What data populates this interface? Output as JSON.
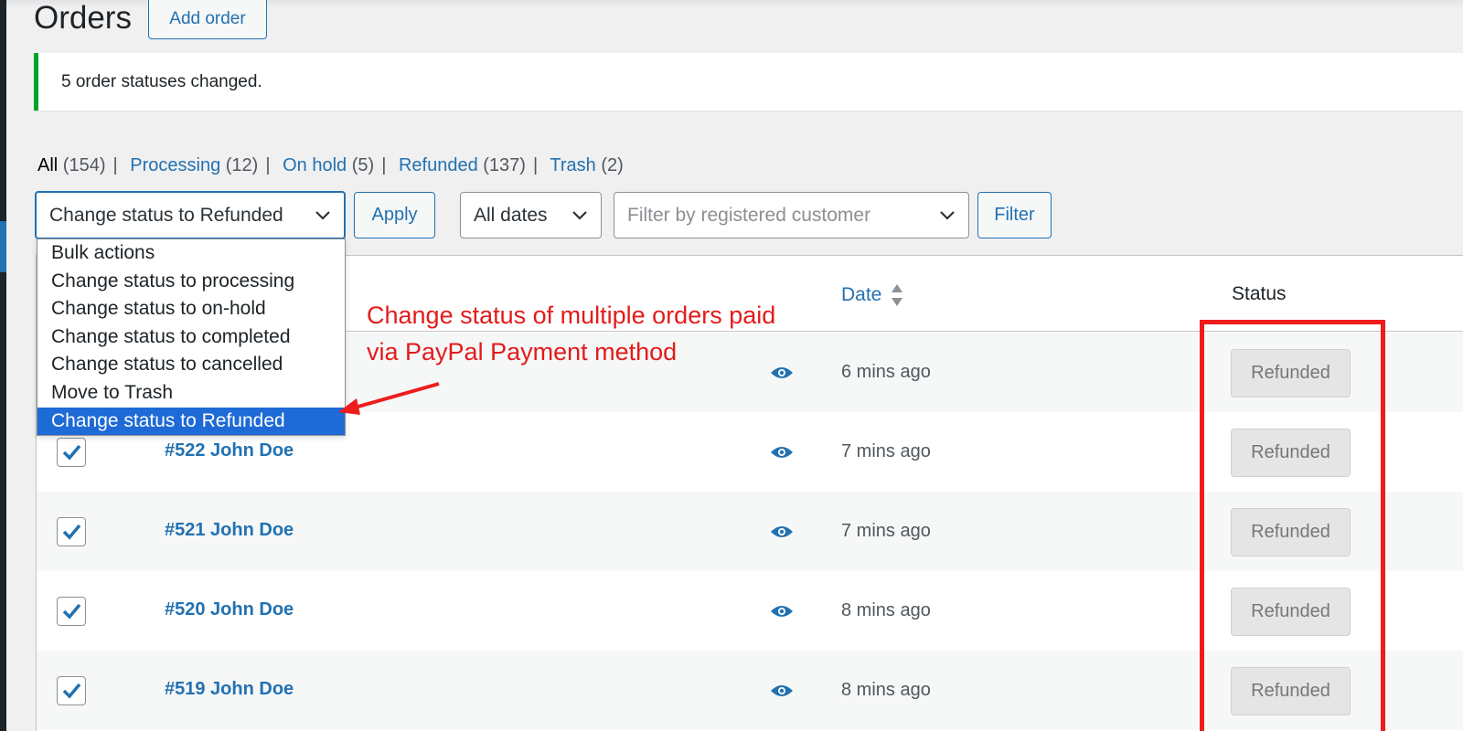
{
  "page": {
    "title": "Orders",
    "add_order_label": "Add order"
  },
  "notice": {
    "message": "5 order statuses changed."
  },
  "views": [
    {
      "label": "All",
      "count": "(154)"
    },
    {
      "label": "Processing",
      "count": "(12)"
    },
    {
      "label": "On hold",
      "count": "(5)"
    },
    {
      "label": "Refunded",
      "count": "(137)"
    },
    {
      "label": "Trash",
      "count": "(2)"
    }
  ],
  "toolbar": {
    "bulk_selected": "Change status to Refunded",
    "apply_label": "Apply",
    "dates_selected": "All dates",
    "customer_placeholder": "Filter by registered customer",
    "filter_label": "Filter"
  },
  "bulk_options": [
    "Bulk actions",
    "Change status to processing",
    "Change status to on-hold",
    "Change status to completed",
    "Change status to cancelled",
    "Move to Trash",
    "Change status to Refunded"
  ],
  "table": {
    "headers": {
      "date": "Date",
      "status": "Status"
    },
    "rows": [
      {
        "order": "",
        "date": "6 mins ago",
        "status": "Refunded"
      },
      {
        "order": "#522 John Doe",
        "date": "7 mins ago",
        "status": "Refunded"
      },
      {
        "order": "#521 John Doe",
        "date": "7 mins ago",
        "status": "Refunded"
      },
      {
        "order": "#520 John Doe",
        "date": "8 mins ago",
        "status": "Refunded"
      },
      {
        "order": "#519 John Doe",
        "date": "8 mins ago",
        "status": "Refunded"
      }
    ]
  },
  "annotation": {
    "line1": "Change status of multiple orders paid",
    "line2": "via PayPal Payment method"
  },
  "colors": {
    "accent": "#2271b1",
    "notice_success": "#00a32a",
    "annotation_red": "#e31b1b",
    "selected_option": "#1e6ad6"
  }
}
